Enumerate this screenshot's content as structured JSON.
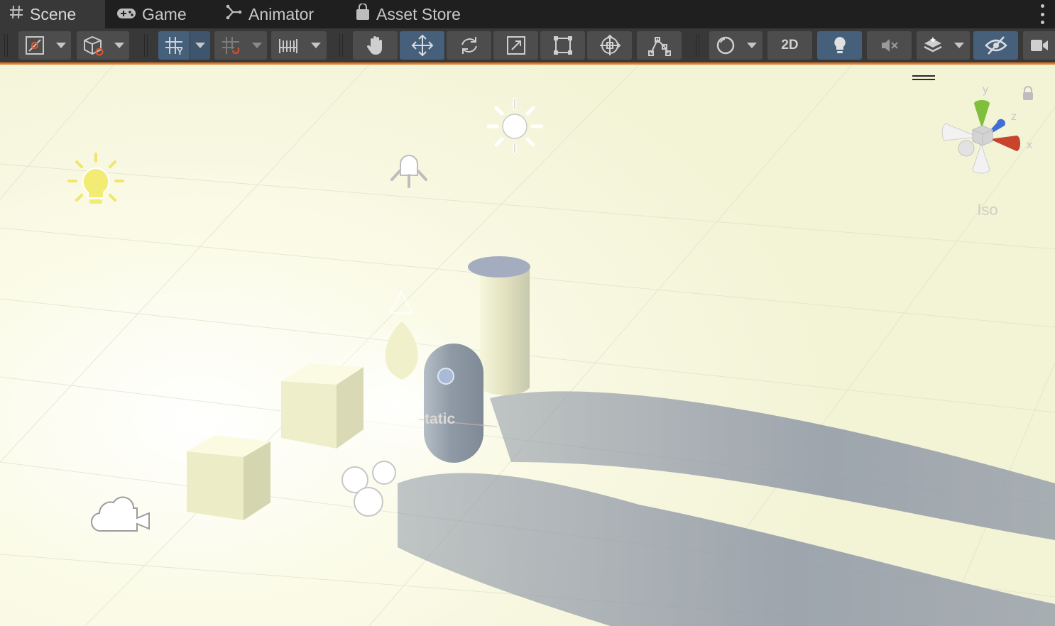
{
  "tabs": [
    {
      "label": "Scene",
      "icon": "grid-hash-icon",
      "active": true
    },
    {
      "label": "Game",
      "icon": "gamepad-icon",
      "active": false
    },
    {
      "label": "Animator",
      "icon": "animator-icon",
      "active": false
    },
    {
      "label": "Asset Store",
      "icon": "shopping-bag-icon",
      "active": false
    }
  ],
  "toolbar": {
    "mode_2d_label": "2D",
    "buttons": [
      "draw-mode-button",
      "scene-camera-button",
      "grid-toggle-button",
      "snap-toggle-button",
      "increment-snap-button",
      "hand-tool-button",
      "move-tool-button",
      "rotate-tool-button",
      "scale-tool-button",
      "rect-tool-button",
      "transform-tool-button",
      "custom-tool-button",
      "shading-mode-button",
      "2d-toggle-button",
      "lighting-toggle-button",
      "audio-toggle-button",
      "effects-button",
      "visibility-toggle-button",
      "camera-settings-button"
    ],
    "active": [
      "move-tool-button",
      "grid-toggle-button",
      "lighting-toggle-button",
      "visibility-toggle-button"
    ]
  },
  "viewport": {
    "orientation_label": "Iso",
    "object_label": "tatic",
    "gizmo_axes": [
      "y",
      "z",
      "x"
    ]
  },
  "colors": {
    "accent": "#e07a2a",
    "active_button": "#46607c",
    "axis_x": "#c8442c",
    "axis_y": "#7fbf3c",
    "axis_z": "#3f6fd6"
  }
}
